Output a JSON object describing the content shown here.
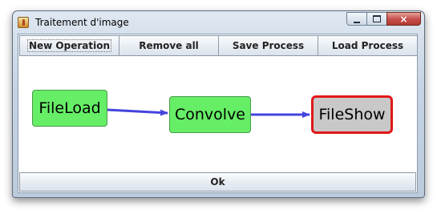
{
  "window": {
    "title": "Traitement d'image",
    "controls": {
      "minimize": "minimize",
      "maximize": "maximize",
      "close": "×"
    }
  },
  "toolbar": {
    "buttons": [
      "New Operation",
      "Remove all",
      "Save Process",
      "Load Process"
    ]
  },
  "graph": {
    "nodes": [
      "FileLoad",
      "Convolve",
      "FileShow"
    ],
    "selected_node": "FileShow",
    "edges": [
      [
        "FileLoad",
        "Convolve"
      ],
      [
        "Convolve",
        "FileShow"
      ]
    ],
    "colors": {
      "node": "#66ee66",
      "selected_fill": "#c8c8c8",
      "selected_border": "#e01818",
      "edge": "#4444dd"
    }
  },
  "footer": {
    "ok_label": "Ok"
  }
}
